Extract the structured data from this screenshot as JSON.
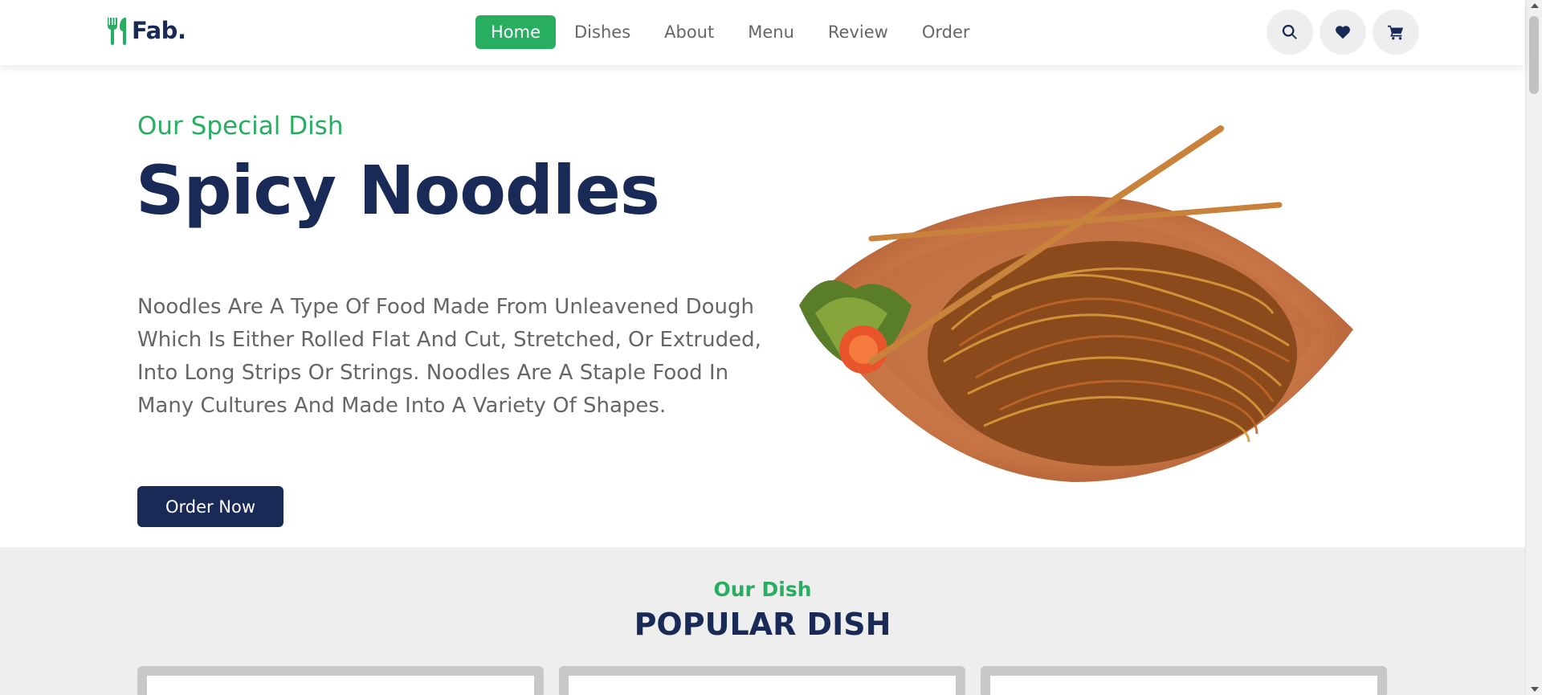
{
  "header": {
    "logo_text": "Fab.",
    "nav": [
      "Home",
      "Dishes",
      "About",
      "Menu",
      "Review",
      "Order"
    ],
    "active_nav": "Home",
    "icons": [
      "search-icon",
      "heart-icon",
      "cart-icon"
    ]
  },
  "hero": {
    "subtitle": "Our Special Dish",
    "title": "Spicy Noodles",
    "description": "Noodles Are A Type Of Food Made From Unleavened Dough Which Is Either Rolled Flat And Cut, Stretched, Or Extruded, Into Long Strips Or Strings. Noodles Are A Staple Food In Many Cultures And Made Into A Variety Of Shapes.",
    "button": "Order Now"
  },
  "popular": {
    "subtitle": "Our Dish",
    "title": "POPULAR DISH"
  },
  "colors": {
    "accent": "#27ae60",
    "primary": "#192a56",
    "text_muted": "#666666"
  }
}
